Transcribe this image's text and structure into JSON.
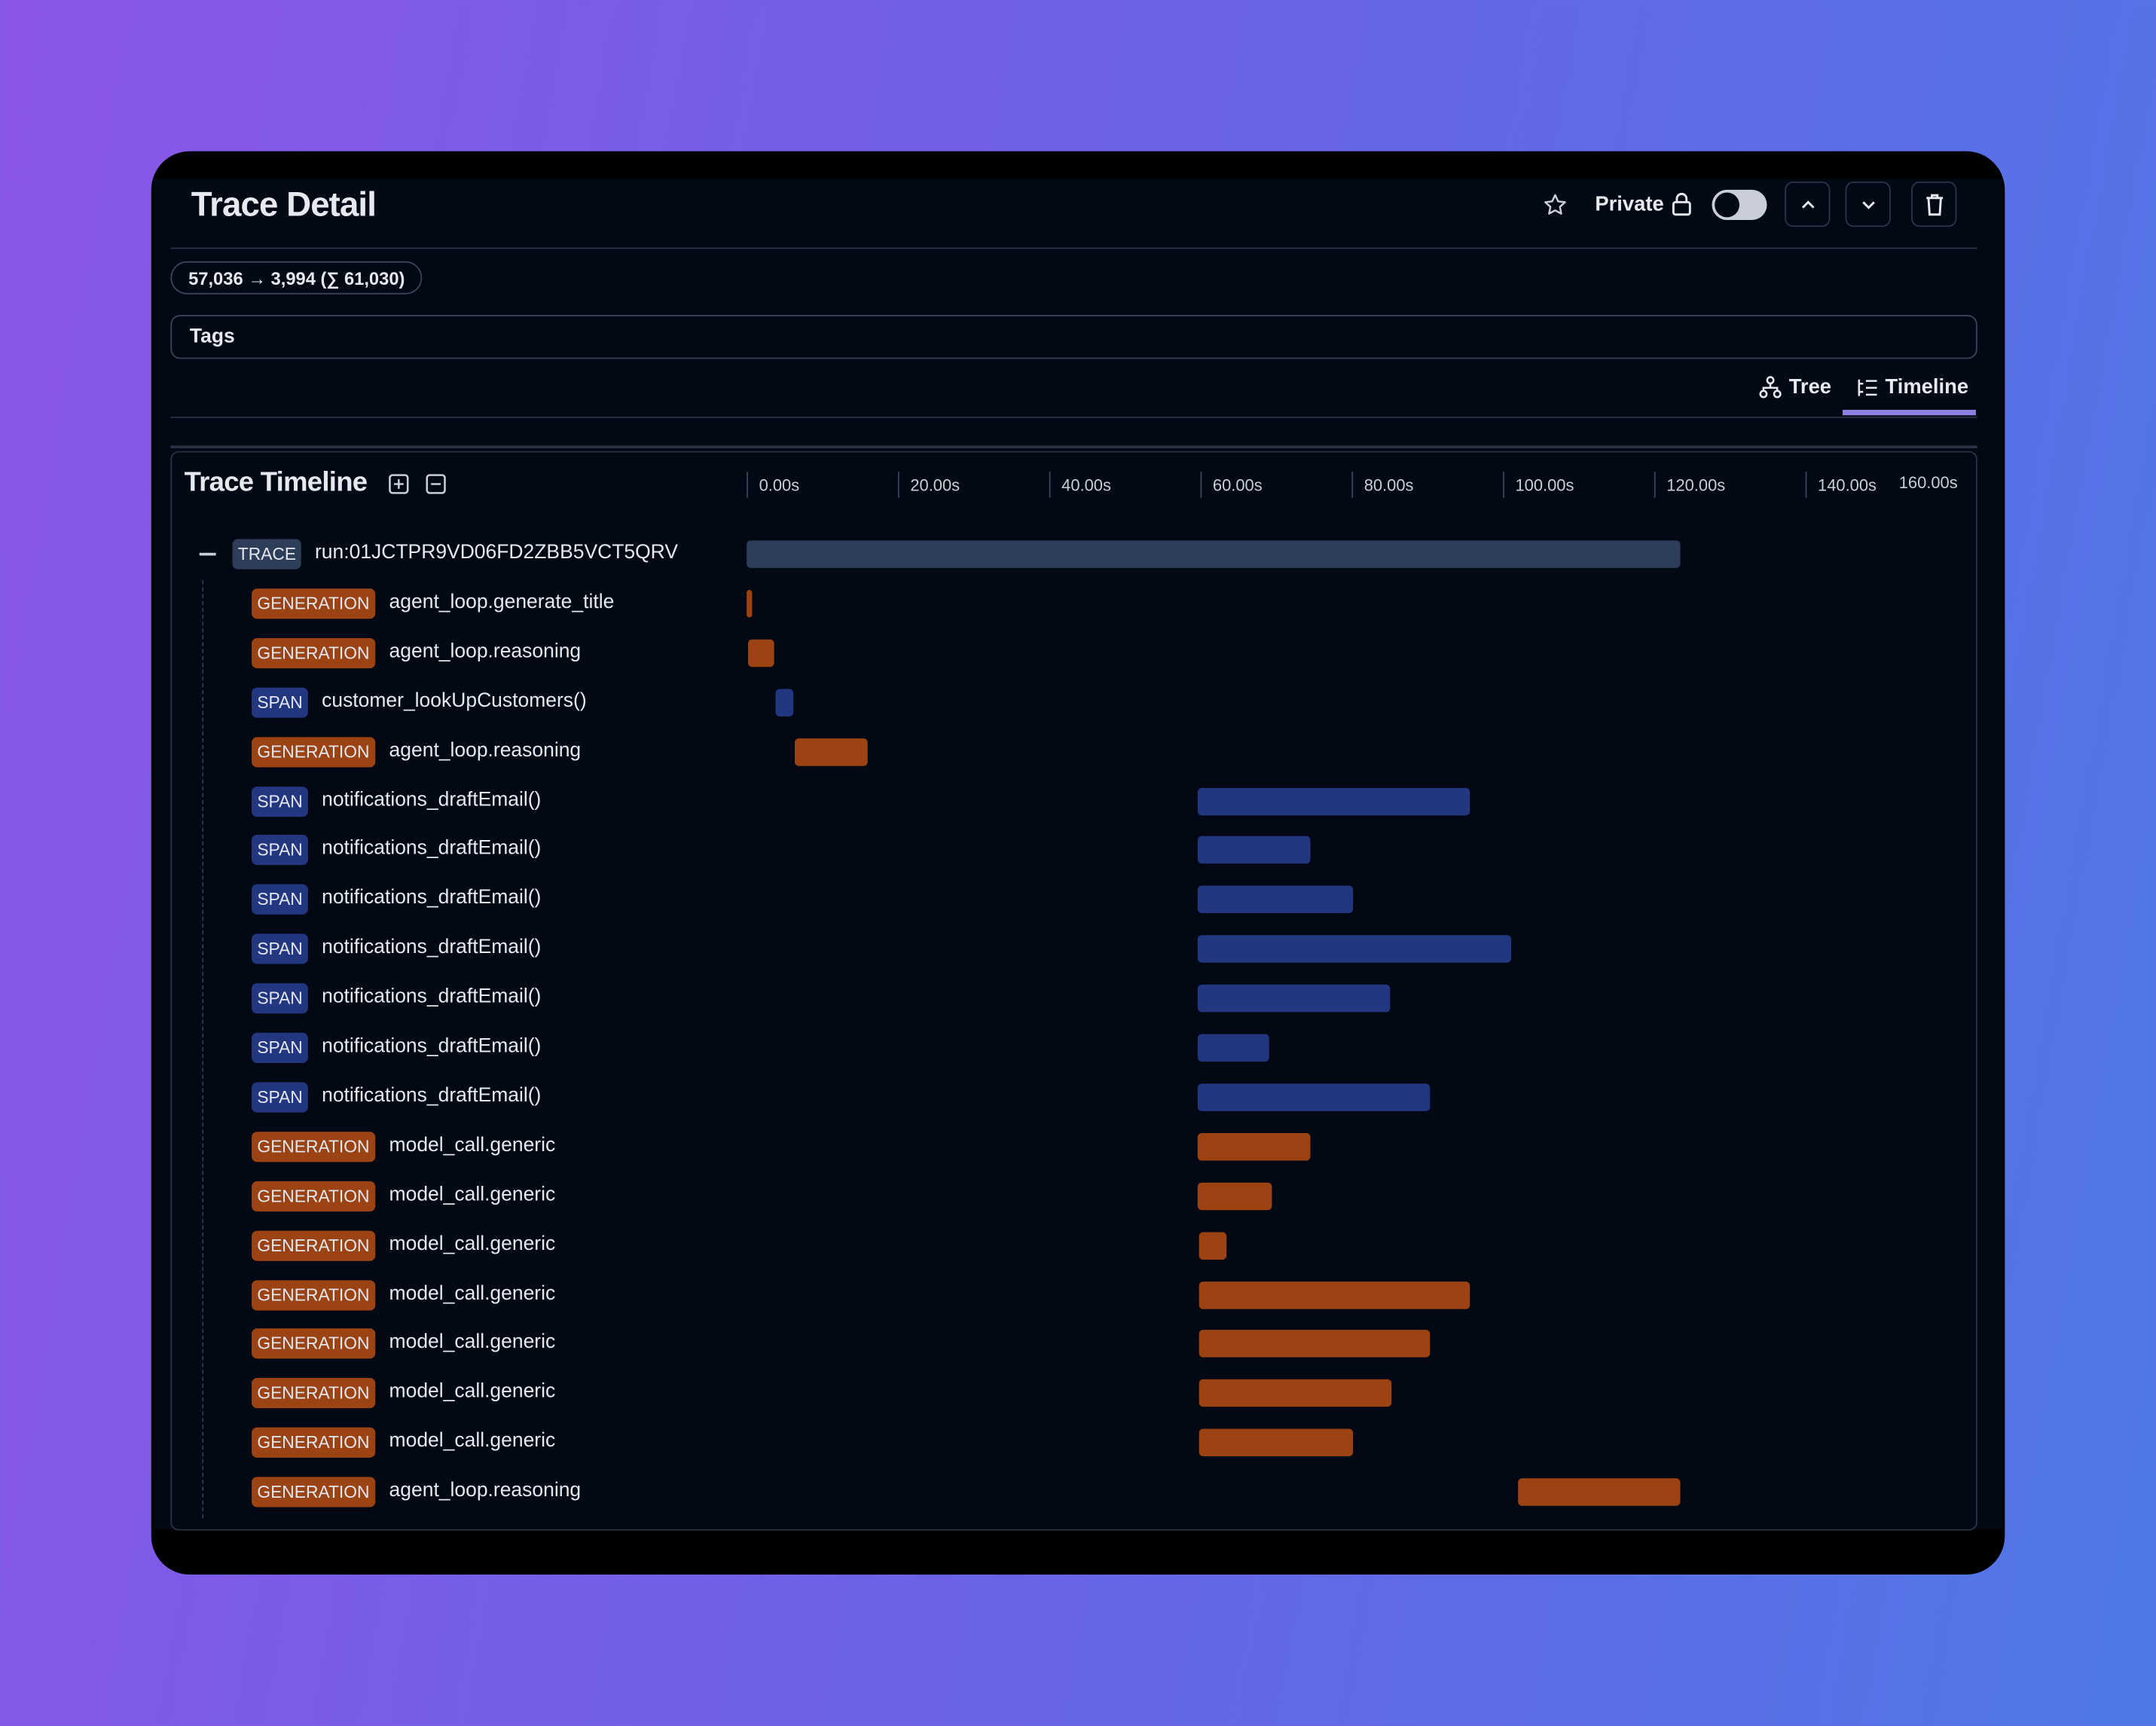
{
  "header": {
    "title": "Trace Detail",
    "private_label": "Private",
    "private_enabled": false
  },
  "tokens": "57,036 → 3,994 (∑ 61,030)",
  "tags_label": "Tags",
  "view_tabs": [
    {
      "label": "Tree",
      "icon": "tree-icon",
      "active": false
    },
    {
      "label": "Timeline",
      "icon": "timeline-icon",
      "active": true
    }
  ],
  "timeline": {
    "title": "Trace Timeline",
    "axis_ticks": [
      "0.00s",
      "20.00s",
      "40.00s",
      "60.00s",
      "80.00s",
      "100.00s",
      "120.00s",
      "140.00s",
      "160.00s"
    ],
    "axis_unit": "s",
    "colors": {
      "GENERATION": "#9b4313",
      "SPAN": "#233680",
      "TRACE": "#2e3d58"
    },
    "rows": [
      {
        "type": "TRACE",
        "name": "run:01JCTPR9VD06FD2ZBB5VCT5QRV",
        "start": 0,
        "end": 123.5
      },
      {
        "type": "GENERATION",
        "name": "agent_loop.generate_title",
        "start": 0,
        "end": 0.7
      },
      {
        "type": "GENERATION",
        "name": "agent_loop.reasoning",
        "start": 0.2,
        "end": 3.6
      },
      {
        "type": "SPAN",
        "name": "customer_lookUpCustomers()",
        "start": 3.8,
        "end": 6.2
      },
      {
        "type": "GENERATION",
        "name": "agent_loop.reasoning",
        "start": 6.4,
        "end": 16.0
      },
      {
        "type": "SPAN",
        "name": "notifications_draftEmail()",
        "start": 59.6,
        "end": 95.6
      },
      {
        "type": "SPAN",
        "name": "notifications_draftEmail()",
        "start": 59.6,
        "end": 74.5
      },
      {
        "type": "SPAN",
        "name": "notifications_draftEmail()",
        "start": 59.6,
        "end": 80.2
      },
      {
        "type": "SPAN",
        "name": "notifications_draftEmail()",
        "start": 59.6,
        "end": 101.1
      },
      {
        "type": "SPAN",
        "name": "notifications_draftEmail()",
        "start": 59.6,
        "end": 85.1
      },
      {
        "type": "SPAN",
        "name": "notifications_draftEmail()",
        "start": 59.6,
        "end": 69.1
      },
      {
        "type": "SPAN",
        "name": "notifications_draftEmail()",
        "start": 59.6,
        "end": 90.4
      },
      {
        "type": "GENERATION",
        "name": "model_call.generic",
        "start": 59.6,
        "end": 74.5
      },
      {
        "type": "GENERATION",
        "name": "model_call.generic",
        "start": 59.6,
        "end": 69.5
      },
      {
        "type": "GENERATION",
        "name": "model_call.generic",
        "start": 59.8,
        "end": 63.5
      },
      {
        "type": "GENERATION",
        "name": "model_call.generic",
        "start": 59.8,
        "end": 95.6
      },
      {
        "type": "GENERATION",
        "name": "model_call.generic",
        "start": 59.8,
        "end": 90.4
      },
      {
        "type": "GENERATION",
        "name": "model_call.generic",
        "start": 59.8,
        "end": 85.3
      },
      {
        "type": "GENERATION",
        "name": "model_call.generic",
        "start": 59.8,
        "end": 80.2
      },
      {
        "type": "GENERATION",
        "name": "agent_loop.reasoning",
        "start": 102.0,
        "end": 123.5
      }
    ]
  }
}
